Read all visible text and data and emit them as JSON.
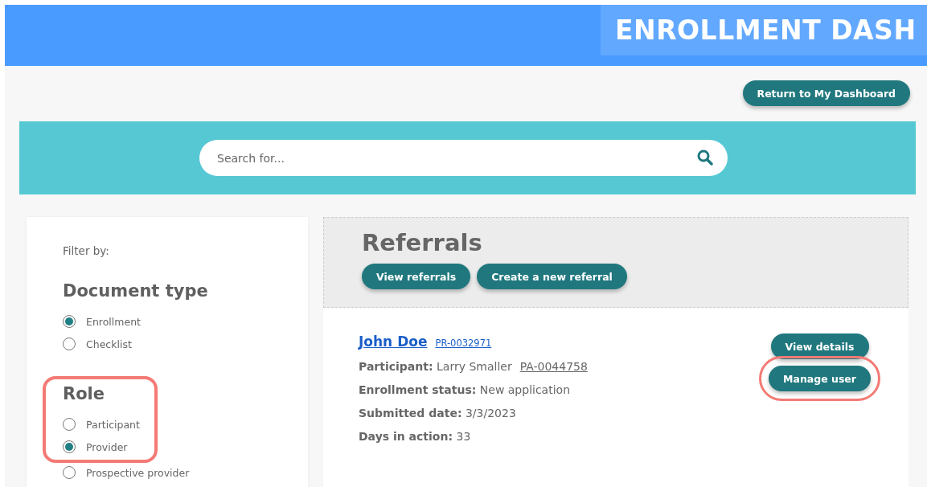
{
  "header": {
    "title": "ENROLLMENT DASH"
  },
  "return_button": "Return to My Dashboard",
  "search": {
    "placeholder": "Search for..."
  },
  "filters": {
    "label": "Filter by:",
    "groups": [
      {
        "title": "Document type",
        "highlighted": false,
        "options": [
          {
            "label": "Enrollment",
            "selected": true
          },
          {
            "label": "Checklist",
            "selected": false
          }
        ]
      },
      {
        "title": "Role",
        "highlighted": true,
        "options": [
          {
            "label": "Participant",
            "selected": false
          },
          {
            "label": "Provider",
            "selected": true
          },
          {
            "label": "Prospective provider",
            "selected": false
          }
        ]
      }
    ]
  },
  "referrals": {
    "title": "Referrals",
    "buttons": [
      "View referrals",
      "Create a new referral"
    ],
    "card": {
      "name": "John Doe",
      "id": "PR-0032971",
      "fields": [
        {
          "label": "Participant:",
          "value": "Larry Smaller",
          "link": "PA-0044758"
        },
        {
          "label": "Enrollment status:",
          "value": "New application"
        },
        {
          "label": "Submitted date:",
          "value": "3/3/2023"
        },
        {
          "label": "Days in action:",
          "value": "33"
        }
      ],
      "actions": [
        {
          "label": "View details",
          "highlighted": false
        },
        {
          "label": "Manage user",
          "highlighted": true
        }
      ]
    }
  }
}
